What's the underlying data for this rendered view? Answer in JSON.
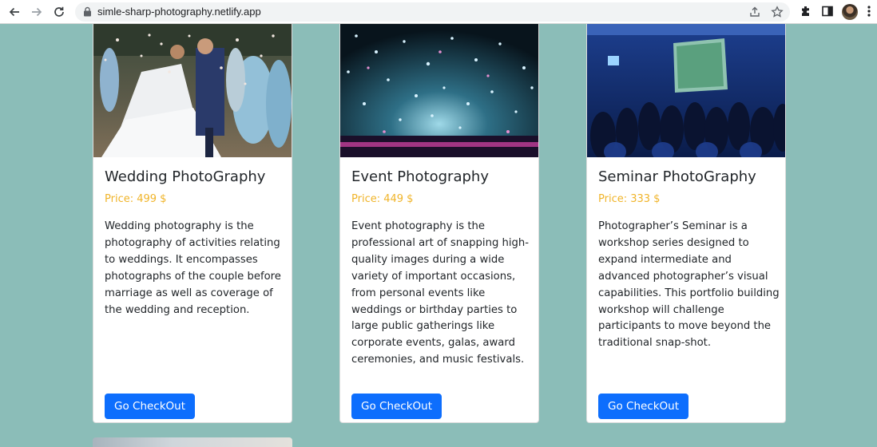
{
  "browser": {
    "url": "simle-sharp-photography.netlify.app",
    "icons": [
      "back-arrow-icon",
      "forward-arrow-icon",
      "reload-icon",
      "lock-icon",
      "share-icon",
      "star-icon",
      "extensions-icon",
      "side-panel-icon",
      "profile-avatar",
      "more-menu-icon"
    ]
  },
  "colors": {
    "background": "#8bbdb8",
    "price": "#f0b429",
    "button": "#0d6efd"
  },
  "cards": [
    {
      "title": "Wedding PhotoGraphy",
      "price": "Price: 499 $",
      "description": "Wedding photography is the photography of activities relating to weddings. It encompasses photographs of the couple before marriage as well as coverage of the wedding and reception.",
      "button": "Go CheckOut"
    },
    {
      "title": "Event Photography",
      "price": "Price: 449 $",
      "description": "Event photography is the professional art of snapping high-quality images during a wide variety of important occasions, from personal events like weddings or birthday parties to large public gatherings like corporate events, galas, award ceremonies, and music festivals.",
      "button": "Go CheckOut"
    },
    {
      "title": "Seminar PhotoGraphy",
      "price": "Price: 333 $",
      "description": "Photographer’s Seminar is a workshop series designed to expand intermediate and advanced photographer’s visual capabilities. This portfolio building workshop will challenge participants to move beyond the traditional snap-shot.",
      "button": "Go CheckOut"
    }
  ]
}
